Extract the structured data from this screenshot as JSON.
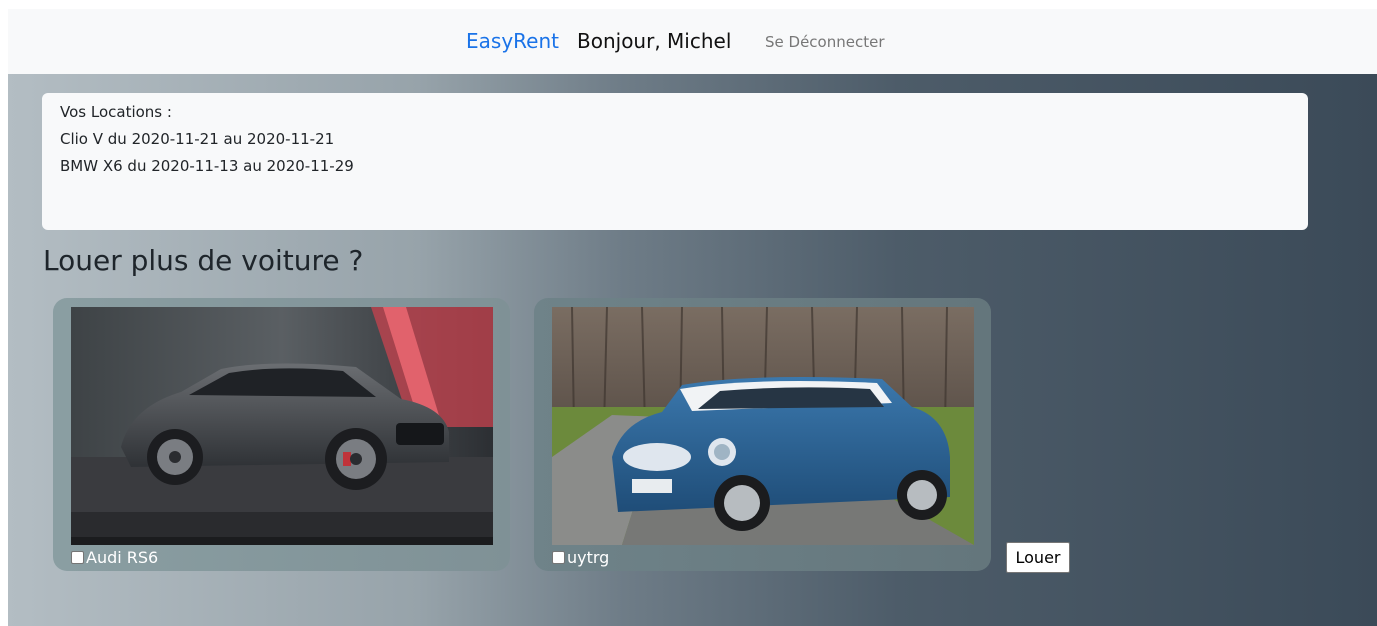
{
  "navbar": {
    "brand": "EasyRent",
    "greeting": "Bonjour, Michel",
    "logout": "Se Déconnecter"
  },
  "rentals": {
    "heading": "Vos Locations :",
    "items": [
      "Clio V du 2020-11-21 au 2020-11-21",
      "BMW X6 du 2020-11-13 au 2020-11-29"
    ]
  },
  "section_title": "Louer plus de voiture ?",
  "cars": [
    {
      "name": "Audi RS6",
      "checked": false
    },
    {
      "name": "uytrg",
      "checked": false
    }
  ],
  "rent_button": "Louer",
  "colors": {
    "brand": "#1a73e8",
    "navbar_bg": "#f8f9fa",
    "panel_bg": "#f8f9fa"
  }
}
